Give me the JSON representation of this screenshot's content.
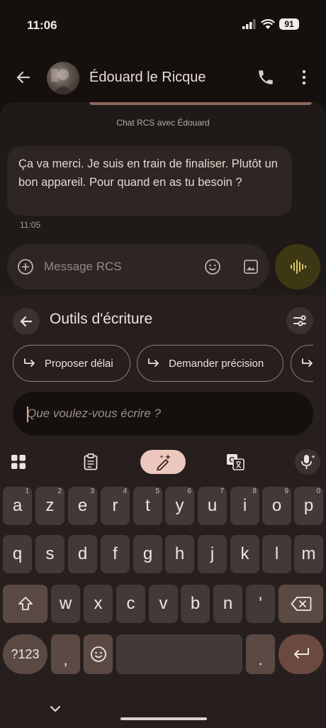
{
  "status_bar": {
    "time": "11:06",
    "battery": "91"
  },
  "header": {
    "contact_name": "Édouard le Ricque"
  },
  "chat": {
    "label": "Chat RCS avec Édouard",
    "message": "Ça va merci. Je suis en train de finaliser. Plutôt un bon appareil. Pour quand en as tu besoin ?",
    "message_time": "11:05"
  },
  "compose": {
    "placeholder": "Message RCS"
  },
  "writing_tools": {
    "title": "Outils d'écriture",
    "chips": [
      "Proposer délai",
      "Demander précision",
      ""
    ],
    "input_placeholder": "Que voulez-vous écrire ?"
  },
  "toolbar": {
    "icons": [
      "apps-grid-icon",
      "clipboard-icon",
      "magic-pen-icon",
      "translate-icon",
      "mic-sparkle-icon"
    ],
    "active": "magic-pen-icon"
  },
  "keyboard": {
    "row1": [
      "a",
      "z",
      "e",
      "r",
      "t",
      "y",
      "u",
      "i",
      "o",
      "p"
    ],
    "row1_hints": [
      "1",
      "2",
      "3",
      "4",
      "5",
      "6",
      "7",
      "8",
      "9",
      "0"
    ],
    "row2": [
      "q",
      "s",
      "d",
      "f",
      "g",
      "h",
      "j",
      "k",
      "l",
      "m"
    ],
    "row3": [
      "w",
      "x",
      "c",
      "v",
      "b",
      "n",
      "'"
    ],
    "symbols_key": "?123",
    "comma_key": ",",
    "period_key": "."
  },
  "colors": {
    "background": "#140f0d",
    "chat_bg": "#1f1a18",
    "bubble": "#2d2623",
    "keyboard_bg": "#261f1d",
    "key": "#433a37",
    "accent": "#ecc7bd",
    "voice_button": "#3e3714"
  }
}
